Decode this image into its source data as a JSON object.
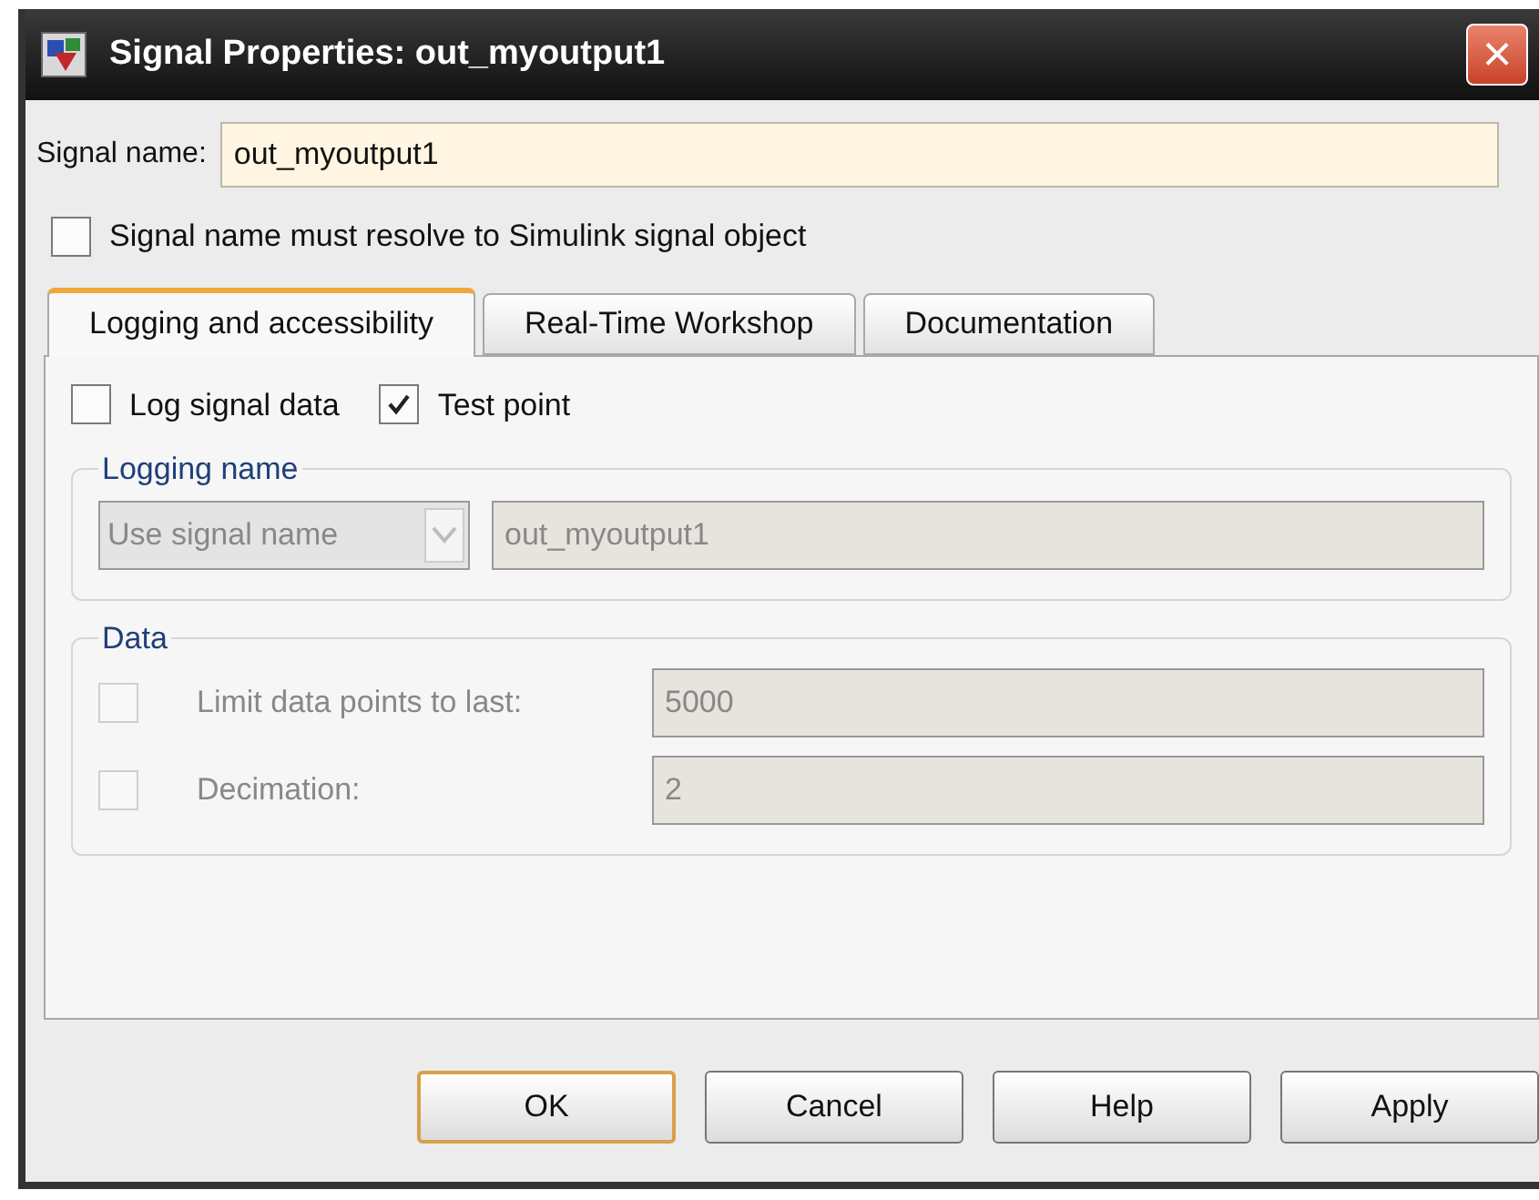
{
  "window": {
    "title": "Signal Properties: out_myoutput1",
    "close": "×"
  },
  "signal_name": {
    "label": "Signal name:",
    "value": "out_myoutput1"
  },
  "resolve_checkbox": {
    "label": "Signal name must resolve to Simulink signal object",
    "checked": false
  },
  "tabs": [
    {
      "label": "Logging and accessibility",
      "selected": true
    },
    {
      "label": "Real-Time Workshop",
      "selected": false
    },
    {
      "label": "Documentation",
      "selected": false
    }
  ],
  "options": [
    {
      "label": "Log signal data",
      "checked": false
    },
    {
      "label": "Test point",
      "checked": true
    }
  ],
  "logging_name": {
    "title": "Logging name",
    "mode": "Use signal name",
    "value": "out_myoutput1",
    "disabled": true
  },
  "data": {
    "title": "Data",
    "rows": [
      {
        "label": "Limit data points to last:",
        "value": "5000",
        "checked": false,
        "disabled": true
      },
      {
        "label": "Decimation:",
        "value": "2",
        "checked": false,
        "disabled": true
      }
    ]
  },
  "buttons": [
    {
      "label": "OK",
      "selected": true
    },
    {
      "label": "Cancel",
      "selected": false
    },
    {
      "label": "Help",
      "selected": false
    },
    {
      "label": "Apply",
      "selected": false
    }
  ]
}
